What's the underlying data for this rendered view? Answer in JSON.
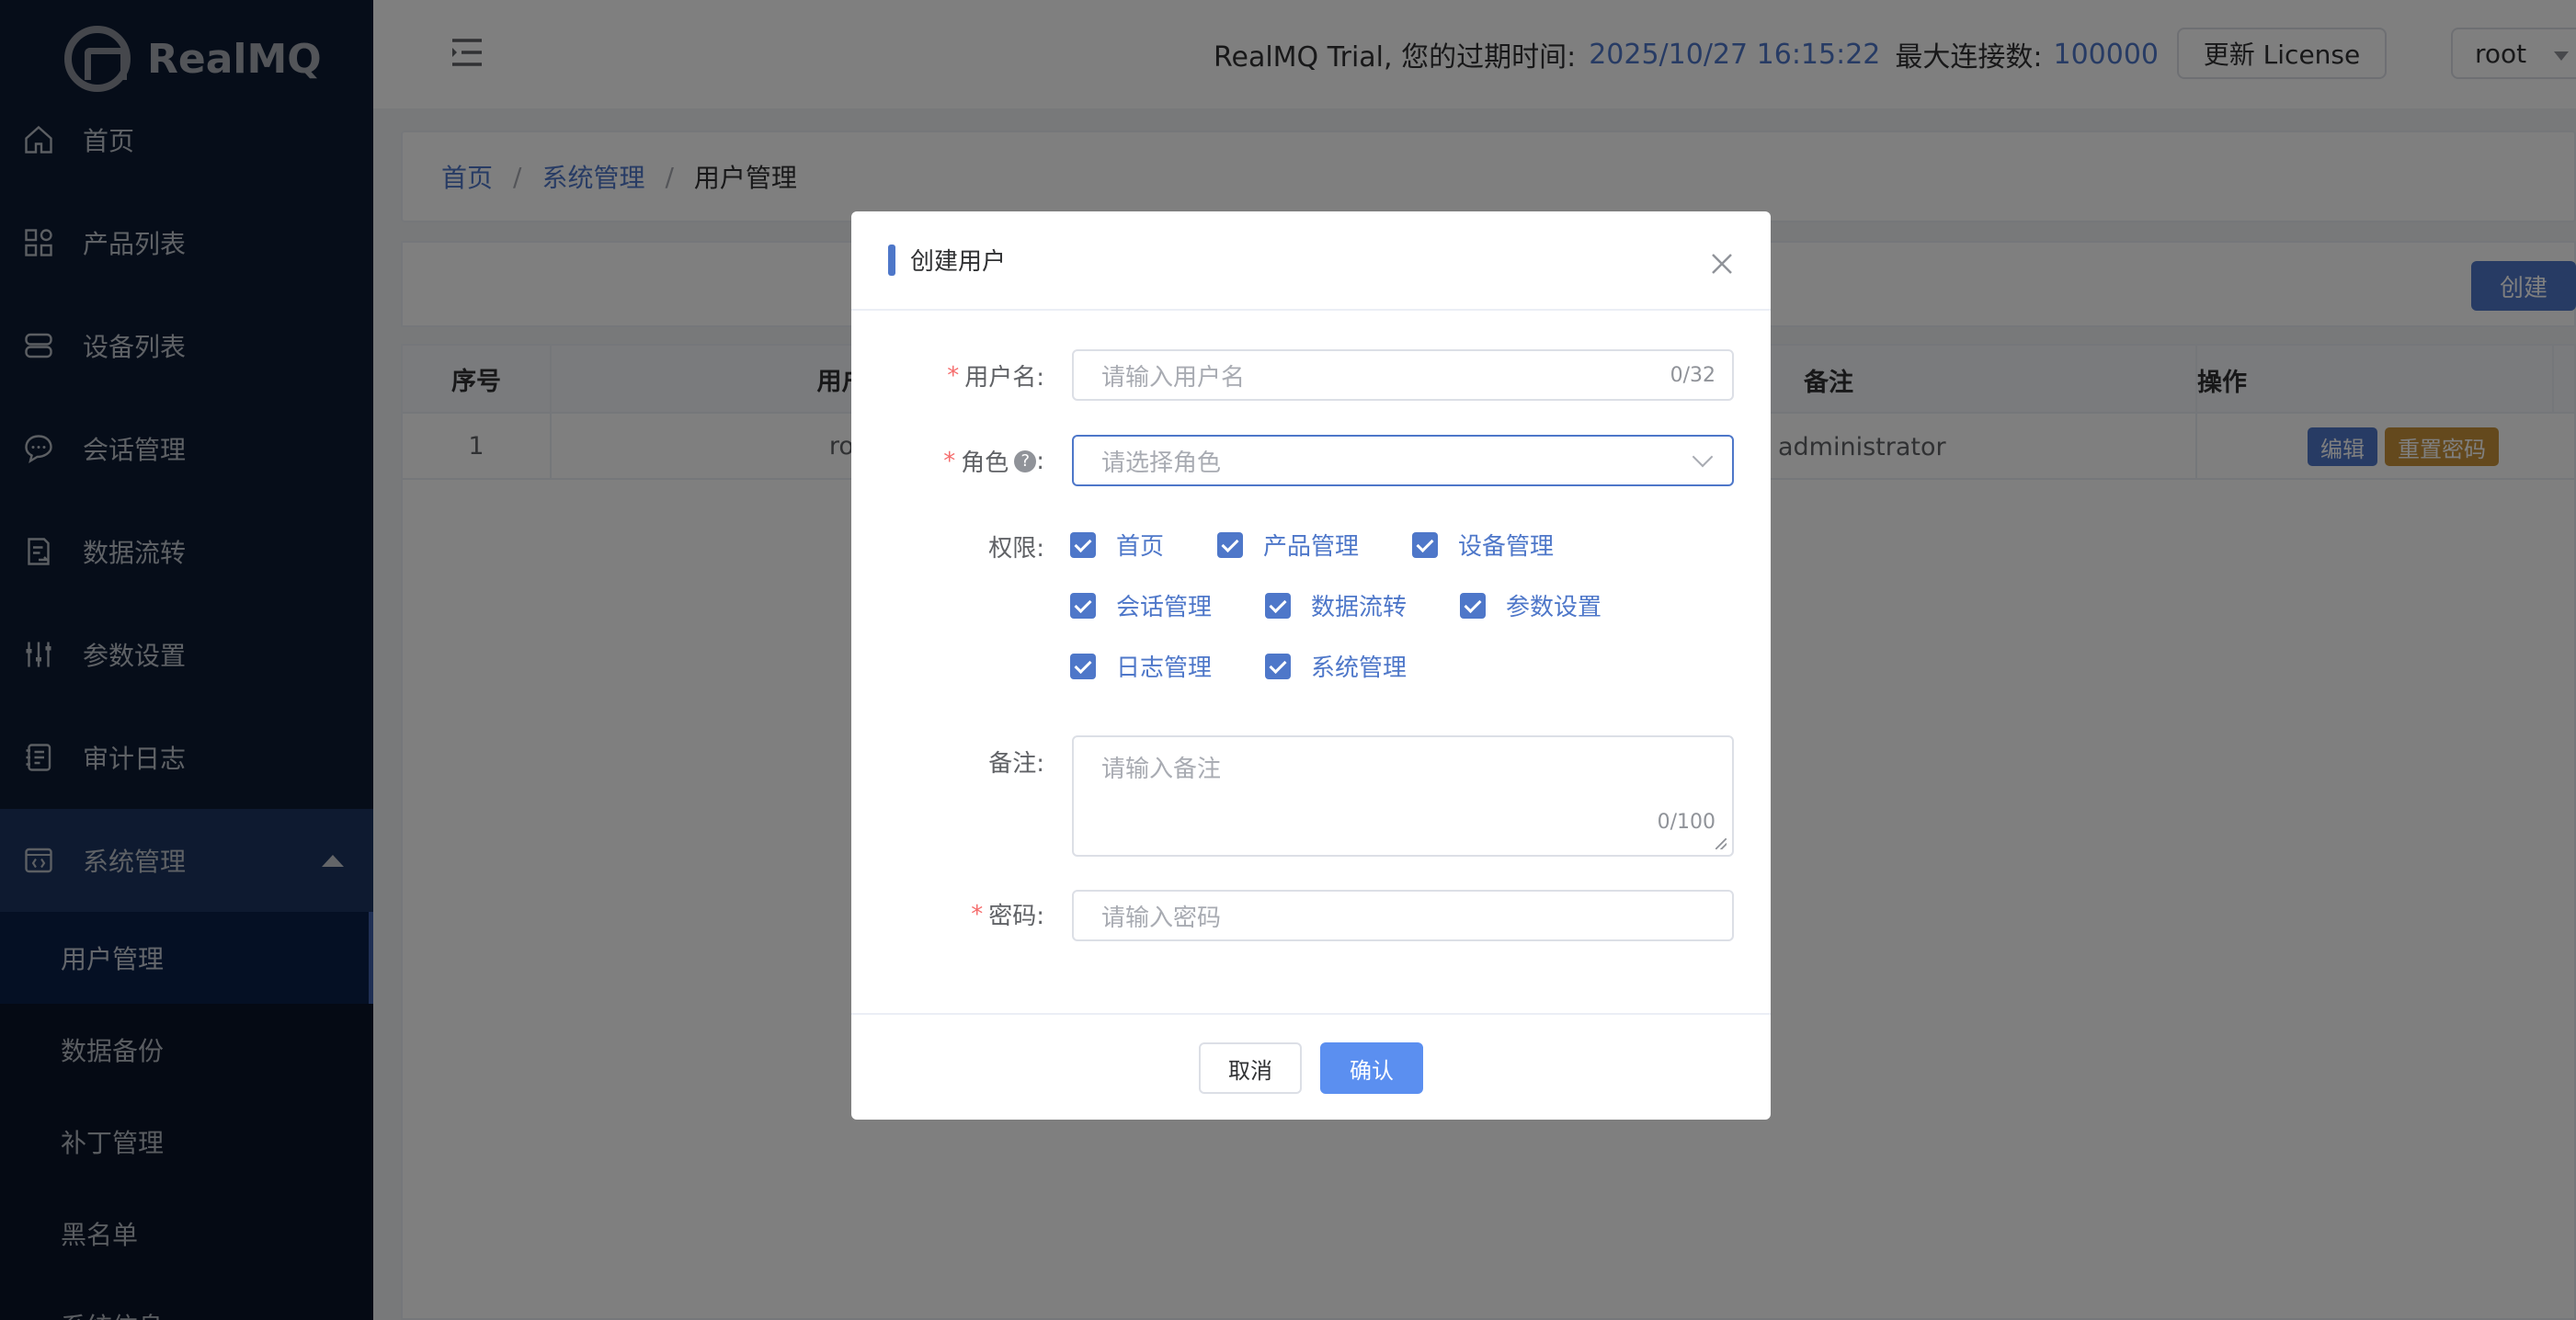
{
  "app": {
    "logo_text": "RealMQ"
  },
  "sidebar": {
    "items": [
      {
        "label": "首页"
      },
      {
        "label": "产品列表"
      },
      {
        "label": "设备列表"
      },
      {
        "label": "会话管理"
      },
      {
        "label": "数据流转"
      },
      {
        "label": "参数设置"
      },
      {
        "label": "审计日志"
      },
      {
        "label": "系统管理"
      }
    ],
    "sub_items": [
      {
        "label": "用户管理"
      },
      {
        "label": "数据备份"
      },
      {
        "label": "补丁管理"
      },
      {
        "label": "黑名单"
      },
      {
        "label": "系统信息"
      }
    ]
  },
  "header": {
    "trial_prefix": "RealMQ Trial, 您的过期时间:",
    "expiry": "2025/10/27 16:15:22",
    "max_conn_label": "最大连接数:",
    "max_conn": "100000",
    "license_button": "更新 License",
    "user": "root"
  },
  "breadcrumb": [
    "首页",
    "系统管理",
    "用户管理"
  ],
  "toolbar": {
    "create_button": "创建"
  },
  "table": {
    "headers": [
      "序号",
      "用户名",
      "备注",
      "操作"
    ],
    "rows": [
      {
        "index": "1",
        "username": "root",
        "remark": "administrator"
      }
    ],
    "actions": {
      "edit": "编辑",
      "reset": "重置密码"
    }
  },
  "dialog": {
    "title": "创建用户",
    "username_label": "用户名:",
    "username_placeholder": "请输入用户名",
    "username_counter": "0/32",
    "role_label": "角色",
    "role_colon": ":",
    "role_placeholder": "请选择角色",
    "permissions_label": "权限:",
    "permissions": [
      "首页",
      "产品管理",
      "设备管理",
      "会话管理",
      "数据流转",
      "参数设置",
      "日志管理",
      "系统管理"
    ],
    "remark_label": "备注:",
    "remark_placeholder": "请输入备注",
    "remark_counter": "0/100",
    "password_label": "密码:",
    "password_placeholder": "请输入密码",
    "cancel": "取消",
    "confirm": "确认",
    "help_glyph": "?"
  },
  "colors": {
    "accent": "#4e77c9",
    "sidebar_bg": "#0d1a33",
    "required": "#f56c6c",
    "reset_tag": "#c8923a"
  }
}
